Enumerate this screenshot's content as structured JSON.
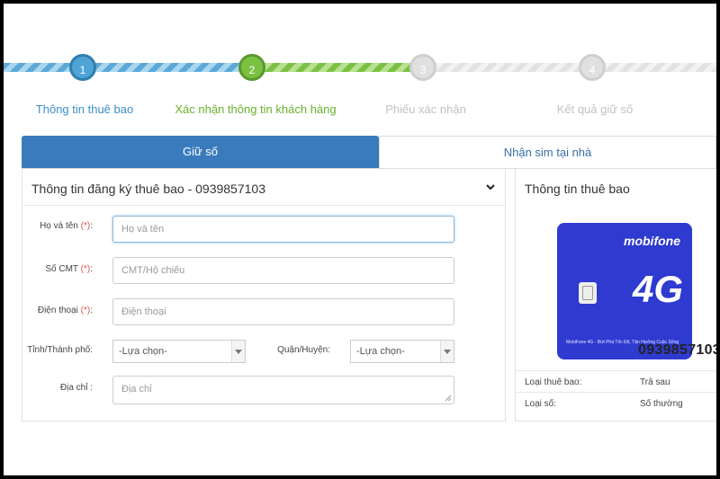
{
  "stepper": {
    "steps": [
      {
        "number": "1",
        "label": "Thông tin thuê bao"
      },
      {
        "number": "2",
        "label": "Xác nhận thông tin khách hàng"
      },
      {
        "number": "3",
        "label": "Phiếu xác nhận"
      },
      {
        "number": "4",
        "label": "Kết quả giữ số"
      }
    ]
  },
  "tabs": {
    "active": "Giữ số",
    "inactive": "Nhận sim tại nhà"
  },
  "form": {
    "title": "Thông tin đăng ký thuê bao - 0939857103",
    "required_mark": "(*)",
    "name_label": "Họ và tên",
    "name_placeholder": "Họ và tên",
    "cmt_label": "Số CMT",
    "cmt_placeholder": "CMT/Hộ chiếu",
    "phone_label": "Điện thoại",
    "phone_placeholder": "Điện thoại",
    "city_label": "Tỉnh/Thành phố:",
    "city_value": "-Lựa chọn-",
    "district_label": "Quận/Huyện:",
    "district_value": "-Lựa chọn-",
    "address_label": "Địa chỉ :",
    "address_placeholder": "Địa chỉ"
  },
  "subscriber": {
    "title": "Thông tin thuê bao",
    "card_brand": "mobifone",
    "card_network": "4G",
    "card_slogan": "MobiFone 4G - Bứt Phá Tốc Độ, Tận Hưởng Cuộc Sống",
    "number": "0939857103",
    "rows": [
      {
        "key": "Loại thuê bao:",
        "value": "Trả sau"
      },
      {
        "key": "Loại số:",
        "value": "Số thường"
      }
    ]
  },
  "colors": {
    "primary_blue": "#3a7bbd",
    "step_green": "#7ac143",
    "required_red": "#d9534f"
  }
}
